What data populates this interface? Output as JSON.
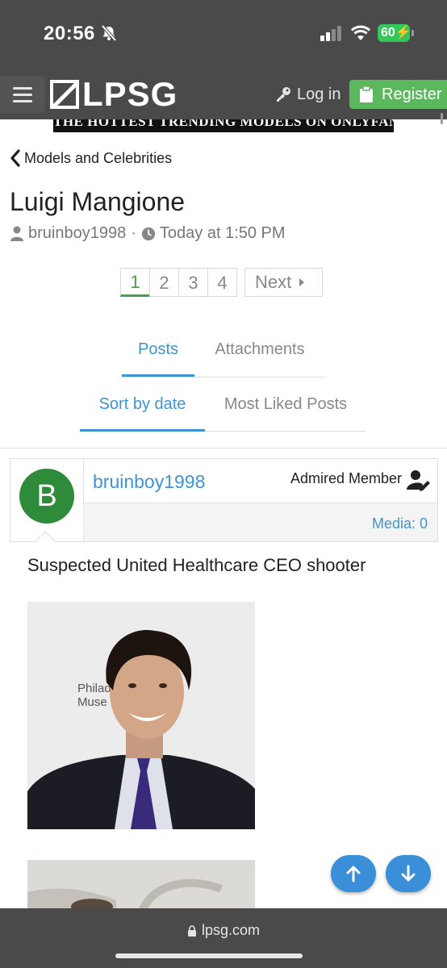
{
  "status_bar": {
    "time": "20:56",
    "battery": "60"
  },
  "header": {
    "logo_text": "LPSG",
    "login_label": "Log in",
    "register_label": "Register"
  },
  "banner": {
    "text": "THE HOTTEST TRENDING MODELS ON ONLYFANS"
  },
  "breadcrumb": {
    "label": "Models and Celebrities"
  },
  "thread": {
    "title": "Luigi Mangione",
    "author": "bruinboy1998",
    "separator": "·",
    "time": "Today at 1:50 PM"
  },
  "pagination": {
    "pages": [
      "1",
      "2",
      "3",
      "4"
    ],
    "current": "1",
    "next_label": "Next"
  },
  "tabs": [
    {
      "label": "Posts",
      "active": true
    },
    {
      "label": "Attachments",
      "active": false
    }
  ],
  "sort_tabs": [
    {
      "label": "Sort by date",
      "active": true
    },
    {
      "label": "Most Liked Posts",
      "active": false
    }
  ],
  "post": {
    "avatar_letter": "B",
    "avatar_color": "#2e8b3a",
    "username": "bruinboy1998",
    "user_title": "Admired Member",
    "media": "Media: 0",
    "text": "Suspected United Healthcare CEO shooter",
    "image_backdrop_text": "Philad\nMuse"
  },
  "url_bar": {
    "domain": "lpsg.com"
  },
  "colors": {
    "accent": "#3e95d1",
    "register": "#5cb85c",
    "header": "#4a4a4a",
    "page_current": "#4a9e4a"
  }
}
